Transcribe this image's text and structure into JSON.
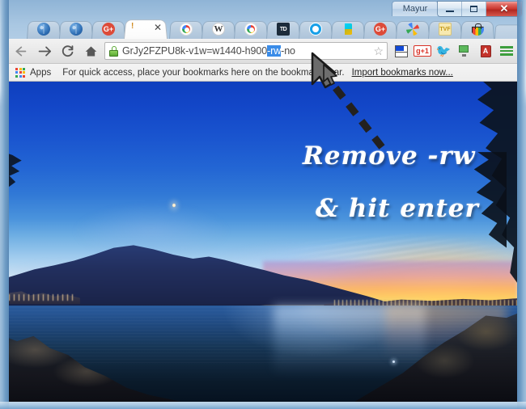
{
  "window": {
    "profile_button_label": "Mayur",
    "controls": {
      "minimize": "minimize-button",
      "maximize": "maximize-button",
      "close_label": "✕"
    }
  },
  "tabs": [
    {
      "title": "",
      "icon": "globe-icon",
      "active": false
    },
    {
      "title": "",
      "icon": "globe-icon",
      "active": false
    },
    {
      "title": "",
      "icon": "google-plus-icon",
      "active": false
    },
    {
      "title": "",
      "icon": "loading-icon",
      "active": true,
      "close_label": "✕"
    },
    {
      "title": "",
      "icon": "chrome-icon",
      "active": false
    },
    {
      "title": "",
      "icon": "wikipedia-icon",
      "active": false
    },
    {
      "title": "",
      "icon": "chrome-icon",
      "active": false
    },
    {
      "title": "",
      "icon": "td-icon",
      "active": false
    },
    {
      "title": "",
      "icon": "opera-icon",
      "active": false
    },
    {
      "title": "",
      "icon": "google-play-icon",
      "active": false
    },
    {
      "title": "",
      "icon": "google-plus-icon",
      "active": false
    },
    {
      "title": "",
      "icon": "google-photos-icon",
      "active": false
    },
    {
      "title": "",
      "icon": "tvf-icon",
      "active": false
    },
    {
      "title": "",
      "icon": "shopping-bag-icon",
      "active": false
    }
  ],
  "toolbar": {
    "back_label": "←",
    "forward_label": "→",
    "reload_label": "↻",
    "home_label": "⌂",
    "omnibox": {
      "security_icon": "lock-icon",
      "url_before": "GrJy2FZPU8k-v1w=w1440-h900",
      "url_selected": "-rw",
      "url_after": "-no",
      "bookmark_star": "☆"
    },
    "extensions": [
      {
        "name": "layout-extension-icon",
        "label": ""
      },
      {
        "name": "google-plus-one-icon",
        "label": "g+1"
      },
      {
        "name": "twitter-bird-icon",
        "label": ""
      },
      {
        "name": "screen-capture-icon",
        "label": ""
      },
      {
        "name": "dictionary-icon",
        "label": "A"
      },
      {
        "name": "chrome-menu-icon",
        "label": ""
      }
    ]
  },
  "bookmarks_bar": {
    "apps_label": "Apps",
    "hint_text": "For quick access, place your bookmarks here on the bookmarks bar.",
    "import_link": "Import bookmarks now..."
  },
  "annotation": {
    "line1": "Remove -rw",
    "line2": "& hit enter",
    "arrow": "dashed-arrow-pointing-to-url",
    "color": "#ffffff"
  },
  "colors": {
    "selection_blue": "#3a8ce8",
    "close_red": "#c9342c",
    "lock_green": "#5aa832",
    "frame_blue": "#7aa5cc"
  },
  "photo": {
    "description": "twilight-lake-panorama"
  }
}
